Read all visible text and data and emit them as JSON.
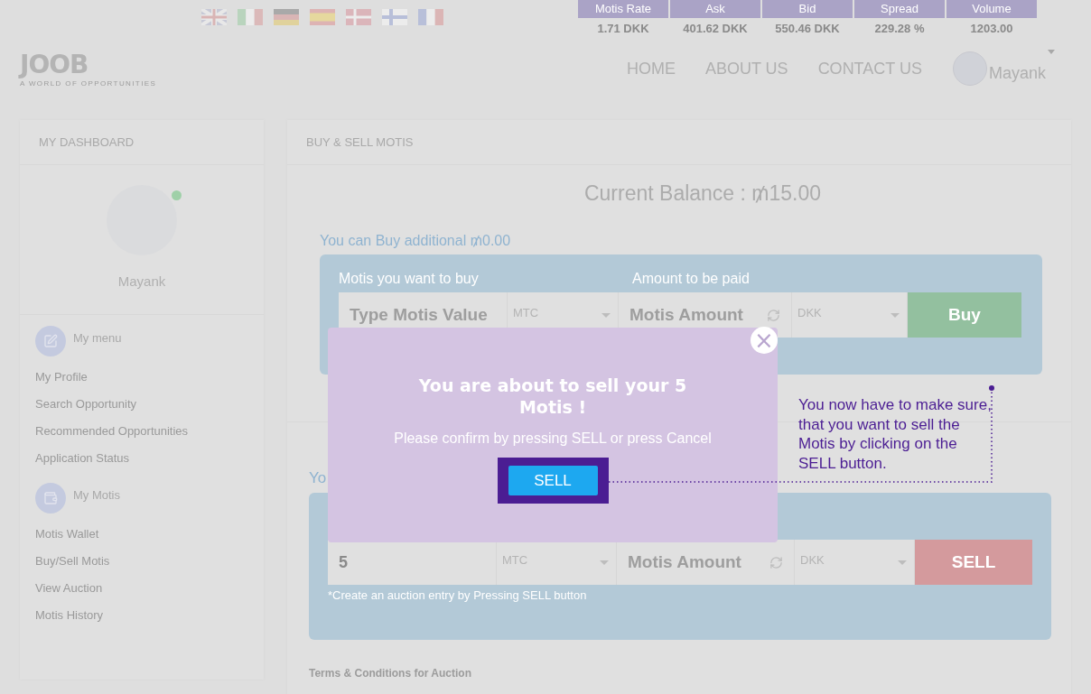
{
  "rates_table": {
    "columns": [
      "Motis Rate",
      "Ask",
      "Bid",
      "Spread",
      "Volume"
    ],
    "values": [
      "1.71 DKK",
      "401.62 DKK",
      "550.46 DKK",
      "229.28 %",
      "1203.00"
    ]
  },
  "logo": {
    "name": "JOOB",
    "tagline": "A WORLD OF OPPORTUNITIES"
  },
  "nav": {
    "items": [
      "HOME",
      "ABOUT US",
      "CONTACT US"
    ],
    "user": "Mayank"
  },
  "sidebar": {
    "title": "MY DASHBOARD",
    "profile": {
      "name": "Mayank",
      "online": true
    },
    "sections": [
      {
        "title": "My menu",
        "kind": "edit",
        "items": [
          "My Profile",
          "Search Opportunity",
          "Recommended Opportunities",
          "Application Status"
        ]
      },
      {
        "title": "My Motis",
        "kind": "wallet",
        "items": [
          "Motis Wallet",
          "Buy/Sell Motis",
          "View Auction",
          "Motis History"
        ]
      }
    ]
  },
  "main": {
    "title": "BUY & SELL MOTIS",
    "balance": "Current Balance : ₥15.00",
    "buy_note": "You can Buy additional ₥0.00",
    "buy": {
      "label_1": "Motis you want to buy",
      "label_2": "Amount to be paid",
      "motis_placeholder": "Type Motis Value",
      "unit": "MTC",
      "amount_placeholder": "Motis Amount",
      "currency": "DKK",
      "button": "Buy"
    },
    "sell_heading": "Yo",
    "sell": {
      "motis_value": "5",
      "unit": "MTC",
      "amount_placeholder": "Motis Amount",
      "currency": "DKK",
      "button": "SELL",
      "note": "*Create an auction entry by Pressing SELL button"
    },
    "terms": "Terms & Conditions for Auction"
  },
  "modal": {
    "title": "You are about to sell your 5 Motis !",
    "message": "Please confirm by pressing SELL or press Cancel",
    "button": "SELL",
    "close": "×"
  },
  "callout": {
    "text": "You now have to make sure, that you want to sell the Motis by clicking on the SELL button."
  }
}
